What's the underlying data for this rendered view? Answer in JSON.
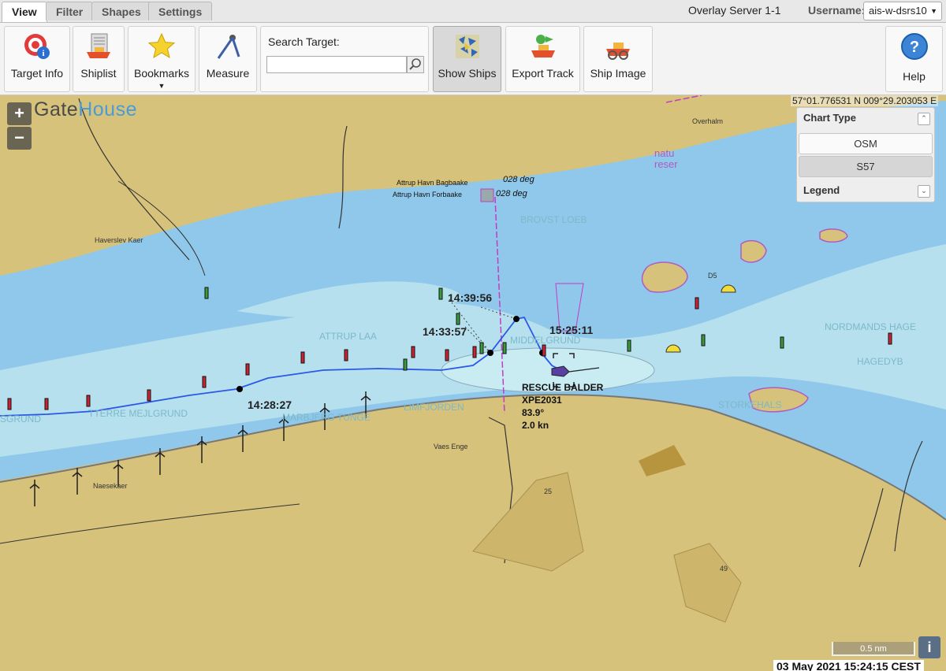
{
  "tabs": [
    "View",
    "Filter",
    "Shapes",
    "Settings"
  ],
  "server": "Overlay Server 1-1",
  "username_label": "Username:",
  "username_value": "ais-w-dsrs10",
  "toolbar": {
    "target_info": "Target Info",
    "shiplist": "Shiplist",
    "bookmarks": "Bookmarks",
    "measure": "Measure",
    "search_label": "Search Target:",
    "search_value": "",
    "show_ships": "Show Ships",
    "export_track": "Export Track",
    "ship_image": "Ship Image",
    "help": "Help"
  },
  "map": {
    "logo_part1": "Gate",
    "logo_part2": "House",
    "coordinates": "57°01.776531 N 009°29.203053 E",
    "chart_type_title": "Chart Type",
    "chart_types": [
      "OSM",
      "S57"
    ],
    "chart_type_selected": "S57",
    "legend_title": "Legend",
    "scale": "0.5 nm",
    "timestamp": "03 May 2021 15:24:15 CEST",
    "place_labels": {
      "overhalm": "Overhalm",
      "nature": "natu",
      "nature2": "reser",
      "bagbaake": "Attrup Havn Bagbaake",
      "forbaake": "Attrup Havn Forbaake",
      "deg1": "028 deg",
      "deg2": "028 deg",
      "brovst": "BROVST LOEB",
      "haverslev": "Haverslev Kaer",
      "attrup_laa": "ATTRUP LAA",
      "middelgrund": "MIDDELGRUND",
      "nordmands": "NORDMANDS HAGE",
      "hagedyb": "HAGEDYB",
      "storkehals": "STORKEHALS",
      "limfjorden": "LIMFJORDEN",
      "marbjerg": "MARBJERG TUNGE",
      "tterre": "TTERRE MEJLGRUND",
      "sgrund": "SGRUND",
      "vaesenge": "Vaes Enge",
      "naeslekaer": "Naesekaer",
      "d5": "D5",
      "n25": "25",
      "n49": "49"
    },
    "track_times": [
      "14:39:56",
      "14:33:57",
      "15:25:11",
      "14:28:27"
    ],
    "ship": {
      "name": "RESCUE BALDER",
      "callsign": "XPE2031",
      "course": "83.9°",
      "speed": "2.0 kn"
    }
  }
}
